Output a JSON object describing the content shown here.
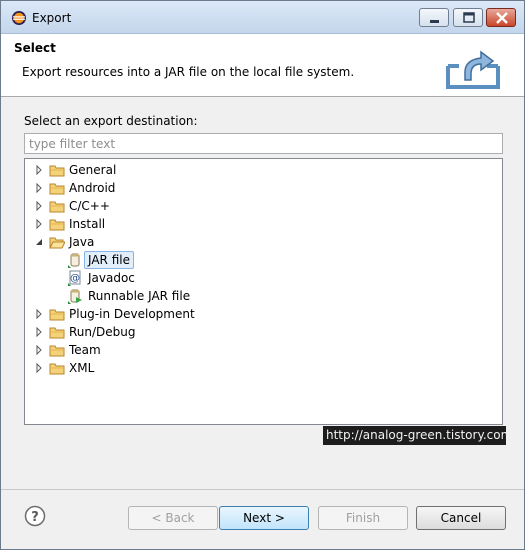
{
  "window": {
    "title": "Export"
  },
  "header": {
    "title": "Select",
    "description": "Export resources into a JAR file on the local file system."
  },
  "destination": {
    "label": "Select an export destination:",
    "filter_placeholder": "type filter text",
    "filter_value": ""
  },
  "tree": {
    "items": [
      {
        "label": "General",
        "type": "folder",
        "expanded": false
      },
      {
        "label": "Android",
        "type": "folder",
        "expanded": false
      },
      {
        "label": "C/C++",
        "type": "folder",
        "expanded": false
      },
      {
        "label": "Install",
        "type": "folder",
        "expanded": false
      },
      {
        "label": "Java",
        "type": "folder",
        "expanded": true
      },
      {
        "label": "JAR file",
        "type": "jar-icon",
        "selected": true
      },
      {
        "label": "Javadoc",
        "type": "javadoc-icon"
      },
      {
        "label": "Runnable JAR file",
        "type": "runnable-jar-icon"
      },
      {
        "label": "Plug-in Development",
        "type": "folder",
        "expanded": false
      },
      {
        "label": "Run/Debug",
        "type": "folder",
        "expanded": false
      },
      {
        "label": "Team",
        "type": "folder",
        "expanded": false
      },
      {
        "label": "XML",
        "type": "folder",
        "expanded": false
      }
    ]
  },
  "watermark": "http://analog-green.tistory.com",
  "buttons": {
    "back": "< Back",
    "next": "Next >",
    "finish": "Finish",
    "cancel": "Cancel"
  },
  "colors": {
    "titlebar": "#c4d6ec",
    "selection": "#e3eefb",
    "folder": "#e8b84a"
  }
}
